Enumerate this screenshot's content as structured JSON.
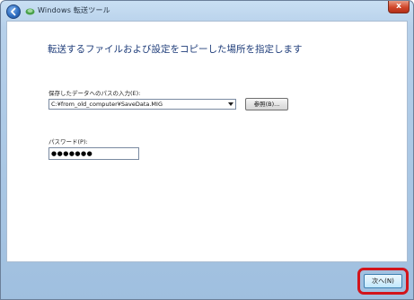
{
  "window": {
    "title": "Windows 転送ツール",
    "close_symbol": "x"
  },
  "page": {
    "heading": "転送するファイルおよび設定をコピーした場所を指定します"
  },
  "path": {
    "label": "保存したデータへのパスの入力(E):",
    "value": "C:¥from_old_computer¥SaveData.MIG",
    "browse_label": "参照(B)..."
  },
  "password": {
    "label": "パスワード(P):",
    "value": "●●●●●●●"
  },
  "footer": {
    "next_label": "次へ(N)"
  },
  "colors": {
    "heading": "#1f3d7a",
    "highlight": "#d2141b"
  },
  "icons": [
    "back-arrow-icon",
    "transfer-app-icon",
    "close-icon",
    "dropdown-arrow-icon"
  ]
}
